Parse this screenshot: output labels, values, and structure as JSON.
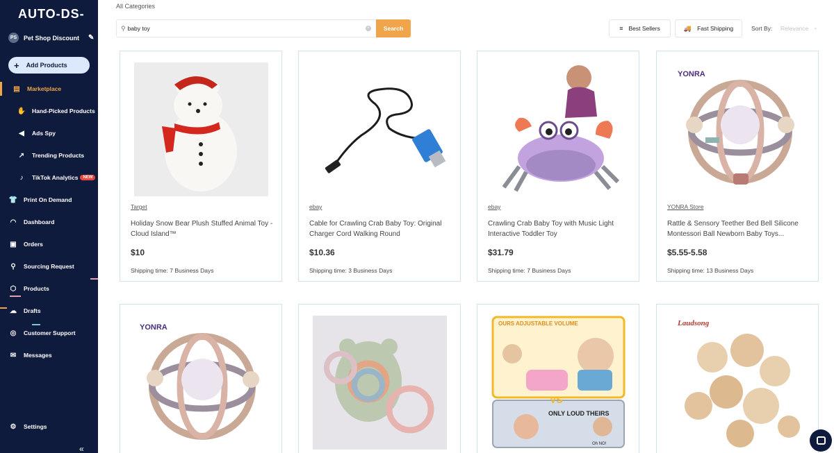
{
  "app": {
    "logo": "AUTO-DS-"
  },
  "sidebar": {
    "store_avatar": "PS",
    "store_name": "Pet Shop Discount",
    "add_products": "Add Products",
    "items": [
      {
        "label": "Marketplace",
        "icon": "store-icon",
        "active": true
      },
      {
        "label": "Hand-Picked Products",
        "icon": "hand-picked-icon"
      },
      {
        "label": "Ads Spy",
        "icon": "megaphone-icon"
      },
      {
        "label": "Trending Products",
        "icon": "trend-chart-icon"
      },
      {
        "label": "TikTok Analytics",
        "icon": "tiktok-icon",
        "badge": "NEW"
      },
      {
        "label": "Print On Demand",
        "icon": "tshirt-icon"
      },
      {
        "label": "Dashboard",
        "icon": "gauge-icon"
      },
      {
        "label": "Orders",
        "icon": "orders-icon"
      },
      {
        "label": "Sourcing Request",
        "icon": "sourcing-icon"
      },
      {
        "label": "Products",
        "icon": "box-icon"
      },
      {
        "label": "Drafts",
        "icon": "cloud-upload-icon"
      },
      {
        "label": "Customer Support",
        "icon": "headset-icon"
      },
      {
        "label": "Messages",
        "icon": "mail-icon"
      },
      {
        "label": "Settings",
        "icon": "gear-icon"
      }
    ],
    "collapse": "«"
  },
  "main": {
    "breadcrumb": "All Categories",
    "search": {
      "value": "baby toy",
      "button": "Search"
    },
    "filters": {
      "best_sellers": "Best Sellers",
      "fast_shipping": "Fast Shipping"
    },
    "sort": {
      "label": "Sort By:",
      "value": "Relevance"
    }
  },
  "products": [
    {
      "store": "Target",
      "title": "Holiday Snow Bear Plush Stuffed Animal Toy - Cloud Island™",
      "price": "$10",
      "shipping": "Shipping time: 7 Business Days"
    },
    {
      "store": "ebay",
      "title": "Cable for Crawling Crab Baby Toy: Original Charger Cord Walking Round",
      "price": "$10.36",
      "shipping": "Shipping time: 3 Business Days"
    },
    {
      "store": "ebay",
      "title": "Crawling Crab Baby Toy with Music Light Interactive Toddler Toy",
      "price": "$31.79",
      "shipping": "Shipping time: 7 Business Days"
    },
    {
      "store": "YONRA Store",
      "title": "Rattle & Sensory Teether Bed Bell Silicone Montessori Ball Newborn Baby Toys...",
      "price": "$5.55-5.58",
      "shipping": "Shipping time: 13 Business Days"
    }
  ],
  "image_text": {
    "brand_yonra": "YONRA",
    "brand_laudsong": "Laudsong",
    "ad_headline": "OURS ADJUSTABLE VOLUME",
    "ad_vs": "VS",
    "ad_loud": "ONLY LOUD THEIRS",
    "ad_ohno": "Oh NO!"
  },
  "colors": {
    "sidebar": "#0f1b3d",
    "accent": "#f0a54a",
    "card_border": "#cfe3f0"
  }
}
